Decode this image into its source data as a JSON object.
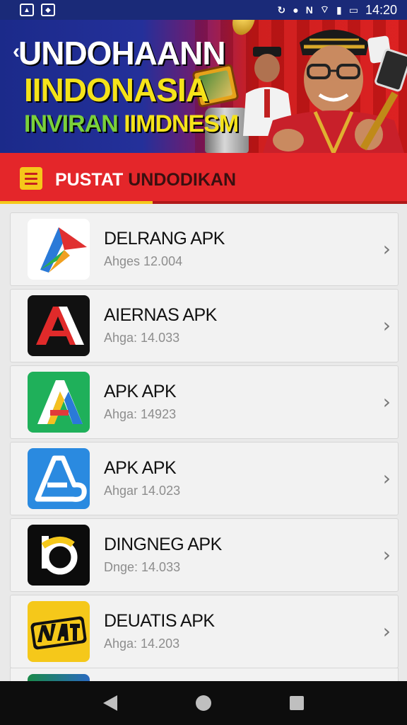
{
  "status_bar": {
    "time": "14:20",
    "left_icons": [
      "image-notification-icon",
      "gallery-notification-icon"
    ],
    "right_icons": [
      "sync-icon",
      "coin-icon",
      "nfc-icon",
      "wifi-icon",
      "signal-icon",
      "signal-icon-2",
      "battery-icon"
    ]
  },
  "banner": {
    "line1": "UNDOHAANN",
    "line2": "IINDONASIA",
    "line3_green": "INVIRAN ",
    "line3_yellow": "IIMDNESM"
  },
  "section": {
    "title_white": "PUSTAT ",
    "title_dark": "UNDODIKAN",
    "accent": "#e4262a",
    "underline_color": "#f5c81a"
  },
  "apps": [
    {
      "name": "DELRANG APK",
      "meta": "Ahges 12.004",
      "icon": "delrang-app-icon"
    },
    {
      "name": "AIERNAS APK",
      "meta": "Ahga: 14.033",
      "icon": "aiernas-app-icon"
    },
    {
      "name": "APK APK",
      "meta": "Ahga: 14923",
      "icon": "green-apk-app-icon"
    },
    {
      "name": "APK APK",
      "meta": "Ahgar 14.023",
      "icon": "blue-apk-app-icon"
    },
    {
      "name": "DINGNEG APK",
      "meta": "Dnge: 14.033",
      "icon": "dingneg-app-icon"
    },
    {
      "name": "DEUATIS APK",
      "meta": "Ahga: 14.203",
      "icon": "deuatis-app-icon"
    }
  ],
  "navigation": [
    "back-icon",
    "home-icon",
    "recents-icon"
  ]
}
